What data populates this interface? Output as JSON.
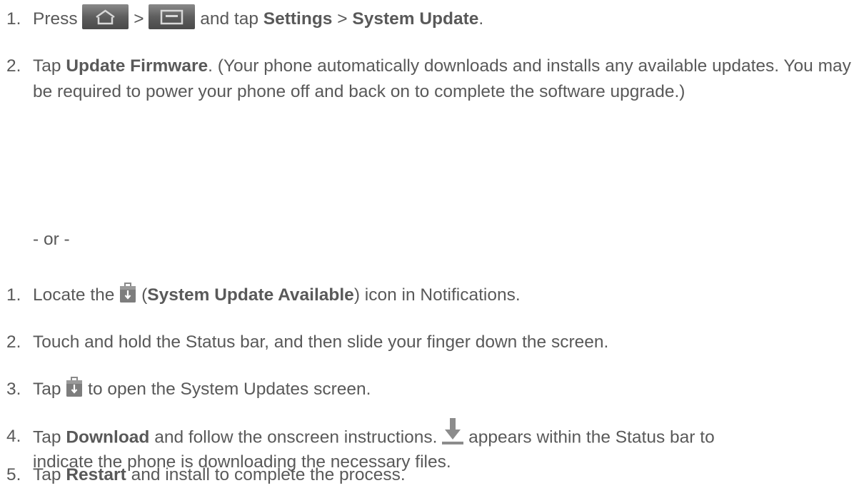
{
  "first_method": {
    "steps": [
      {
        "number": "1.",
        "press": "Press",
        "sep": ">",
        "and_tap": "and tap",
        "settings": "Settings",
        "gt": ">",
        "system_update": "System Update",
        "end": "."
      },
      {
        "number": "2.",
        "tap": "Tap",
        "update_firmware": "Update Firmware",
        "rest": ". (Your phone automatically downloads and installs any available updates. You may be required to power your phone off and back on to complete the software upgrade.)"
      }
    ]
  },
  "or_separator": "- or -",
  "second_method": {
    "steps": [
      {
        "number": "1.",
        "locate": "Locate the",
        "open_paren": "(",
        "icon_name": "System Update Available",
        "rest": ") icon in Notifications."
      },
      {
        "number": "2.",
        "text": "Touch and hold the Status bar, and then slide your finger down the screen."
      },
      {
        "number": "3.",
        "tap": "Tap",
        "rest": "to open the System Updates screen."
      },
      {
        "number": "4.",
        "tap": "Tap",
        "download": "Download",
        "middle": "and follow the onscreen instructions.",
        "rest_line1": "appears within the Status bar to",
        "line2": "indicate the phone is downloading the necessary files."
      },
      {
        "number": "5.",
        "tap": "Tap",
        "restart": "Restart",
        "rest": "and install to complete the process."
      }
    ]
  },
  "icons": {
    "home": "home-key-icon",
    "menu": "menu-key-icon",
    "system_update": "system-update-icon",
    "download": "download-icon"
  },
  "colors": {
    "text": "#595959",
    "icon_gray": "#8a8a8a",
    "button_bg": "#6a6a6a"
  }
}
